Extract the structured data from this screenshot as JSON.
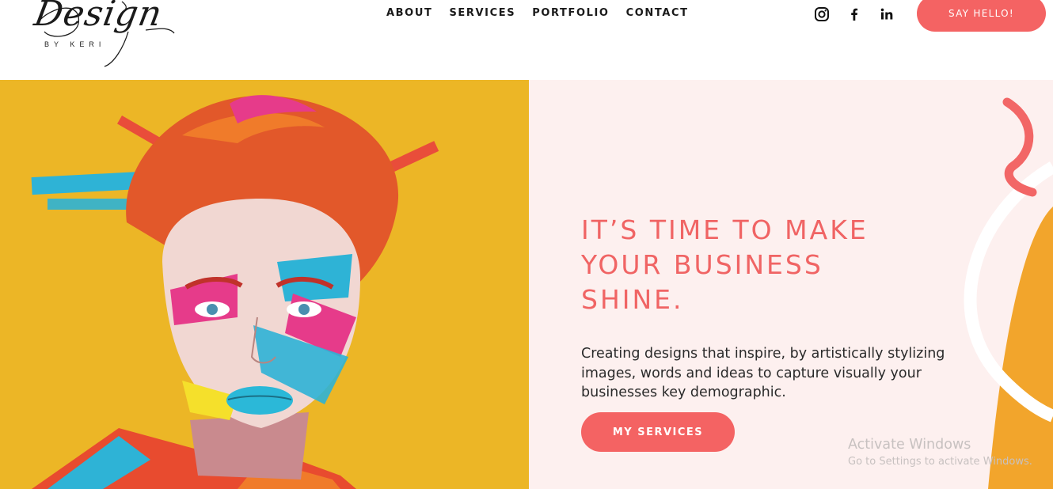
{
  "logo": {
    "script": "Design",
    "sub": "BY KERI"
  },
  "nav": {
    "items": [
      {
        "label": "ABOUT"
      },
      {
        "label": "SERVICES"
      },
      {
        "label": "PORTFOLIO"
      },
      {
        "label": "CONTACT"
      }
    ]
  },
  "social": {
    "icons": [
      "instagram-icon",
      "facebook-icon",
      "linkedin-icon"
    ]
  },
  "header": {
    "cta_label": "SAY HELLO!"
  },
  "hero": {
    "headline": "IT’S TIME TO MAKE YOUR BUSINESS SHINE.",
    "subtext": "Creating designs that inspire, by artistically stylizing images, words and ideas to capture visually your businesses key demographic.",
    "button_label": "MY SERVICES"
  },
  "watermark": {
    "title": "Activate Windows",
    "subtitle": "Go to Settings to activate Windows."
  },
  "colors": {
    "accent": "#f46363",
    "headline": "#f06464",
    "hero_left_bg": "#ecb626",
    "hero_right_bg": "#fdf0ef"
  }
}
